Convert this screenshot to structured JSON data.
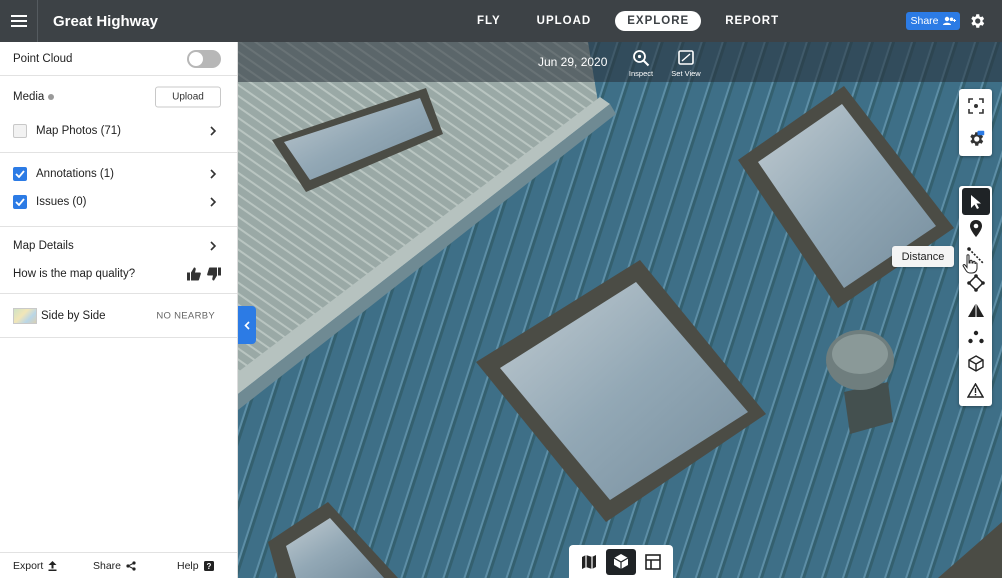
{
  "header": {
    "project_title": "Great Highway",
    "nav_tabs": [
      {
        "label": "FLY",
        "active": false
      },
      {
        "label": "UPLOAD",
        "active": false
      },
      {
        "label": "EXPLORE",
        "active": true
      },
      {
        "label": "REPORT",
        "active": false
      }
    ],
    "share_label": "Share",
    "icons": [
      "hamburger-menu-icon",
      "add-users-icon",
      "gear-icon"
    ]
  },
  "sidebar": {
    "point_cloud": {
      "label": "Point Cloud",
      "enabled": false
    },
    "media": {
      "label": "Media",
      "upload_label": "Upload"
    },
    "map_photos": {
      "label": "Map Photos (71)",
      "checked": false
    },
    "annotations": {
      "label": "Annotations (1)",
      "checked": true
    },
    "issues": {
      "label": "Issues (0)",
      "checked": true
    },
    "map_details": {
      "label": "Map Details"
    },
    "map_quality": {
      "label": "How is the map quality?"
    },
    "side_by_side": {
      "label": "Side by Side",
      "status": "NO NEARBY"
    },
    "footer": {
      "export_label": "Export",
      "share_label": "Share",
      "help_label": "Help"
    }
  },
  "map": {
    "date": "Jun 29, 2020",
    "inspect_label": "Inspect",
    "set_view_label": "Set View",
    "tooltip": "Distance",
    "tools": [
      "select-cursor-icon",
      "location-pin-icon",
      "distance-ruler-icon",
      "area-polygon-icon",
      "elevation-icon",
      "points-icon",
      "volume-cube-icon",
      "warning-triangle-icon"
    ],
    "view_modes": [
      "2d-map-icon",
      "3d-model-icon",
      "layout-compare-icon"
    ],
    "active_view_mode": "3d-model-icon"
  },
  "colors": {
    "topbar": "#3d4246",
    "accent_blue": "#2c7be5",
    "roof_blue": "#3e6f87",
    "roof_grey": "#9aa9a6"
  }
}
